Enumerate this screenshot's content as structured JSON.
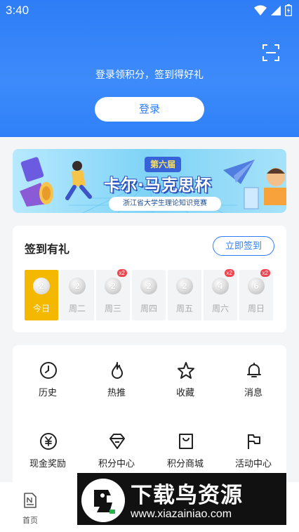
{
  "status_bar": {
    "time": "3:40"
  },
  "header": {
    "login_tip": "登录领积分，签到得好礼",
    "login_button": "登录"
  },
  "banner": {
    "badge": "第六届",
    "title": "卡尔·马克思杯",
    "subtitle": "浙江省大学生理论知识竞赛"
  },
  "checkin": {
    "title": "签到有礼",
    "button": "立即签到",
    "days": [
      {
        "points": "2",
        "label": "今日",
        "double": ""
      },
      {
        "points": "2",
        "label": "周二",
        "double": ""
      },
      {
        "points": "2",
        "label": "周三",
        "double": "x2"
      },
      {
        "points": "2",
        "label": "周四",
        "double": ""
      },
      {
        "points": "2",
        "label": "周五",
        "double": ""
      },
      {
        "points": "4",
        "label": "周六",
        "double": "x2"
      },
      {
        "points": "6",
        "label": "周日",
        "double": "x2"
      }
    ]
  },
  "menu": {
    "items": [
      {
        "label": "历史",
        "icon": "clock-icon"
      },
      {
        "label": "热推",
        "icon": "flame-icon"
      },
      {
        "label": "收藏",
        "icon": "star-icon"
      },
      {
        "label": "消息",
        "icon": "bell-icon"
      },
      {
        "label": "现金奖励",
        "icon": "yuan-icon"
      },
      {
        "label": "积分中心",
        "icon": "diamond-icon"
      },
      {
        "label": "积分商城",
        "icon": "shopping-bag-icon"
      },
      {
        "label": "活动中心",
        "icon": "flag-icon"
      }
    ]
  },
  "bottom_nav": {
    "home": "首页"
  },
  "watermark": {
    "title": "下载鸟资源",
    "url": "www.xiazainiao.com"
  },
  "colors": {
    "primary": "#2f7df6",
    "active_day": "#f5b800",
    "badge_red": "#f0434d"
  }
}
